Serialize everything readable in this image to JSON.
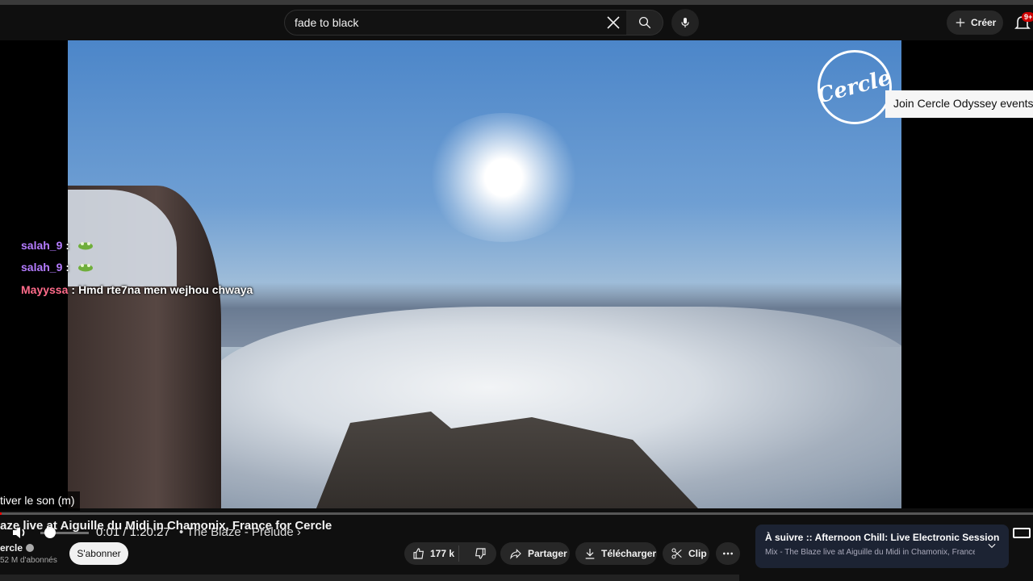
{
  "search": {
    "query": "fade to black"
  },
  "header": {
    "create_label": "Créer",
    "notif_badge": "9+"
  },
  "player": {
    "overlay_card": "Join Cercle Odyssey events",
    "logo_text": "Cercle",
    "chat": [
      {
        "user": "salah_9",
        "msg": ""
      },
      {
        "user": "salah_9",
        "msg": ""
      },
      {
        "user": "Mayyssa",
        "msg": "Hmd rte7na men wejhou chwaya"
      }
    ],
    "chat_sep": ":",
    "unmute_tooltip": "tiver le son (m)",
    "time": "0:01 / 1:20:27",
    "chapter": "• The Blaze - Prelude ›",
    "progress_fraction": 0.0002,
    "volume_fraction": 0.2
  },
  "video": {
    "title": "aze live at Aiguille du Midi in Chamonix, France for Cercle",
    "channel": "ercle",
    "subscribers": "52 M d'abonnés",
    "subscribe_label": "S'abonner"
  },
  "actions": {
    "likes": "177 k",
    "share": "Partager",
    "download": "Télécharger",
    "clip": "Clip"
  },
  "upnext": {
    "title": "À suivre :: Afternoon Chill: Live Electronic Session",
    "subtitle": "Mix - The Blaze live at Aiguille du Midi in Chamonix, France f..."
  }
}
